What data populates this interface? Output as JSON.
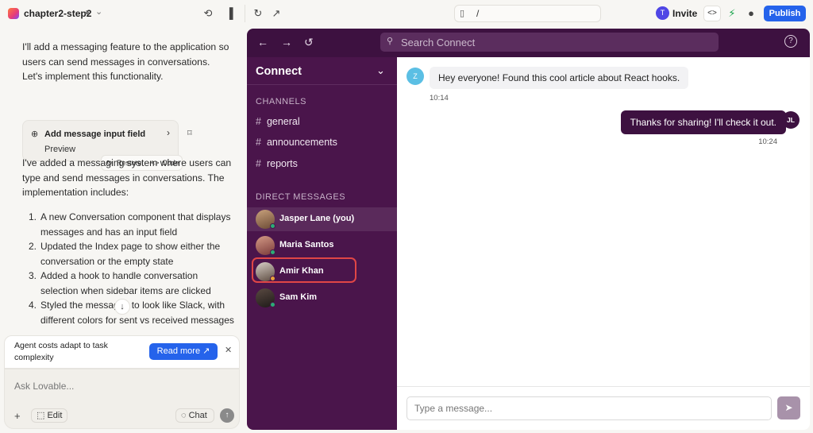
{
  "topbar": {
    "project_name": "chapter2-step2",
    "url_path": "/",
    "invite_initial": "T",
    "invite_label": "Invite",
    "publish_label": "Publish"
  },
  "chat": {
    "intro": "I'll add a messaging feature to the application so users can send messages in conversations. Let's implement this functionality.",
    "card": {
      "title": "Add message input field",
      "preview_label": "Preview"
    },
    "restore_label": "Restore",
    "code_label": "Code",
    "summary": "I've added a messaging system where users can type and send messages in conversations. The implementation includes:",
    "items": [
      {
        "num": "1.",
        "text": "A new Conversation component that displays messages and has an input field"
      },
      {
        "num": "2.",
        "text": "Updated the Index page to show either the conversation or the empty state"
      },
      {
        "num": "3.",
        "text": "Added a hook to handle conversation selection when sidebar items are clicked"
      },
      {
        "num": "4.",
        "text": "Styled the messages to look like Slack, with different colors for sent vs received messages"
      }
    ],
    "toast": {
      "text": "Agent costs adapt to task complexity",
      "read_more": "Read more"
    },
    "composer": {
      "placeholder": "Ask Lovable...",
      "edit_label": "Edit",
      "chat_label": "Chat"
    }
  },
  "app": {
    "search_placeholder": "Search Connect",
    "workspace": "Connect",
    "channels_header": "CHANNELS",
    "channels": [
      "general",
      "announcements",
      "reports"
    ],
    "dm_header": "DIRECT MESSAGES",
    "dms": [
      {
        "name": "Jasper Lane (you)",
        "status_color": "#2bac76"
      },
      {
        "name": "Maria Santos",
        "status_color": "#2bac76"
      },
      {
        "name": "Amir Khan",
        "status_color": "#e8a13a"
      },
      {
        "name": "Sam Kim",
        "status_color": "#2bac76"
      }
    ],
    "messages": [
      {
        "avatar": "Z",
        "text": "Hey everyone! Found this cool article about React hooks.",
        "time": "10:14"
      },
      {
        "avatar": "JL",
        "text": "Thanks for sharing! I'll check it out.",
        "time": "10:24"
      }
    ],
    "message_placeholder": "Type a message..."
  },
  "colors": {
    "brand_purple": "#4a154b",
    "publish_blue": "#2563eb",
    "highlight_red": "#e04646"
  }
}
